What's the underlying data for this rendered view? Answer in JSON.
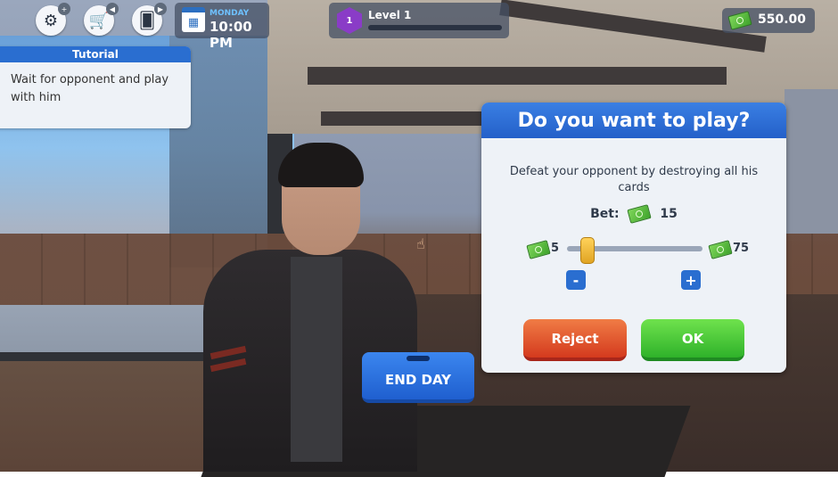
{
  "hud": {
    "icons": [
      "settings-icon",
      "shop-cart-icon",
      "cards-icon"
    ],
    "date": {
      "day": "MONDAY",
      "time": "10:00 PM"
    },
    "level": {
      "number": "1",
      "label": "Level 1",
      "progress": 0
    },
    "money": "550.00"
  },
  "tutorial": {
    "title": "Tutorial",
    "text": "Wait for opponent and play with him"
  },
  "end_day_label": "END DAY",
  "dialog": {
    "title": "Do you want to play?",
    "message": "Defeat your opponent by destroying all his cards",
    "bet_label": "Bet:",
    "bet_value": "15",
    "slider": {
      "min": "5",
      "max": "75",
      "value": 15,
      "min_value": 5,
      "max_value": 75
    },
    "minus_label": "-",
    "plus_label": "+",
    "reject_label": "Reject",
    "ok_label": "OK"
  },
  "colors": {
    "accent_blue": "#2a6ed0",
    "reject_red": "#d43a1e",
    "ok_green": "#2fb22a",
    "level_purple": "#8a3cc7"
  }
}
